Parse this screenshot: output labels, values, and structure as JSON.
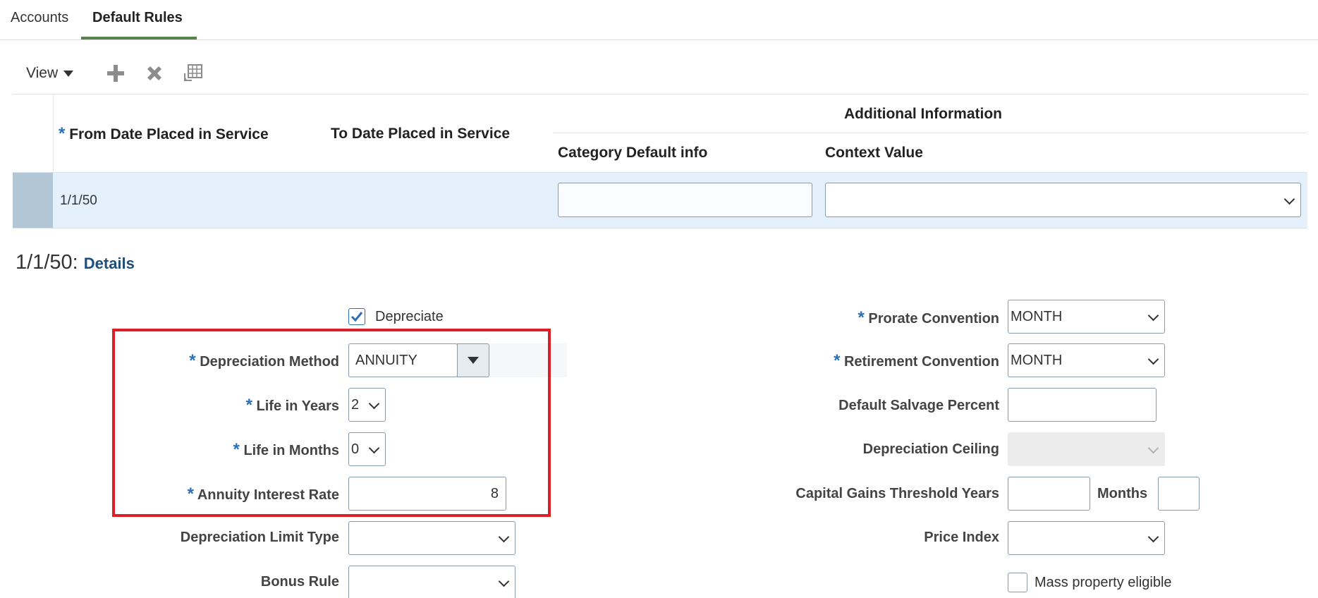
{
  "tabs": [
    {
      "label": "Accounts",
      "active": false
    },
    {
      "label": "Default Rules",
      "active": true
    }
  ],
  "toolbar": {
    "view_label": "View",
    "icons": [
      "add-icon",
      "delete-icon",
      "freeze-columns-icon"
    ]
  },
  "table": {
    "required_marker": "*",
    "headers": {
      "from_date": "From Date Placed in Service",
      "to_date": "To Date Placed in Service",
      "group": "Additional Information",
      "category_default": "Category Default info",
      "context_value": "Context Value"
    },
    "rows": [
      {
        "from_date": "1/1/50",
        "to_date": "",
        "category_default": "",
        "context_value": ""
      }
    ]
  },
  "details": {
    "title_prefix": "1/1/50:",
    "title_link": "Details",
    "left": {
      "depreciate_label": "Depreciate",
      "depreciate_checked": true,
      "method_label": "Depreciation Method",
      "method_value": "ANNUITY",
      "life_years_label": "Life in Years",
      "life_years_value": "2",
      "life_months_label": "Life in Months",
      "life_months_value": "0",
      "interest_label": "Annuity Interest Rate",
      "interest_value": "8",
      "limit_type_label": "Depreciation Limit Type",
      "limit_type_value": "",
      "bonus_rule_label": "Bonus Rule",
      "bonus_rule_value": ""
    },
    "right": {
      "prorate_label": "Prorate Convention",
      "prorate_value": "MONTH",
      "retirement_label": "Retirement Convention",
      "retirement_value": "MONTH",
      "salvage_label": "Default Salvage Percent",
      "salvage_value": "",
      "ceiling_label": "Depreciation Ceiling",
      "ceiling_value": "",
      "capital_gains_label": "Capital Gains Threshold Years",
      "capital_gains_years_value": "",
      "months_label": "Months",
      "months_value": "",
      "price_index_label": "Price Index",
      "price_index_value": "",
      "mass_property_label": "Mass property eligible",
      "mass_property_checked": false
    }
  },
  "colors": {
    "accent_tab": "#5b8350",
    "required_marker": "#2b6fb5",
    "selected_row": "#e4f0fb",
    "highlight": "#dc1f26",
    "link": "#1f4e79"
  }
}
